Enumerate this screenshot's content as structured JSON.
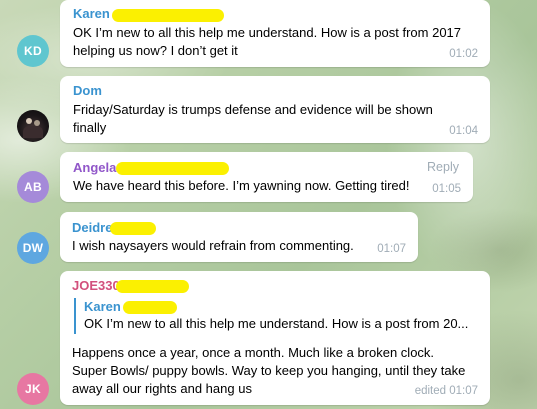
{
  "messages": [
    {
      "sender": "Karen",
      "sender_color": "#3a93cf",
      "avatar_initials": "KD",
      "avatar_color": "#5fc6cf",
      "text": "OK I’m new to all this help me understand. How is a post from 2017 helping us now? I don’t get it",
      "time": "01:02"
    },
    {
      "sender": "Dom",
      "sender_color": "#3a93cf",
      "avatar_icon": "user-photo-icon",
      "text": "Friday/Saturday is trumps defense and evidence will be shown finally",
      "time": "01:04"
    },
    {
      "sender": "Angela",
      "sender_color": "#9157c9",
      "avatar_initials": "AB",
      "avatar_color": "#a58ad9",
      "text": "We have heard this before. I’m yawning now. Getting tired!",
      "time": "01:05",
      "reply_label": "Reply"
    },
    {
      "sender": "Deidre",
      "sender_color": "#3a93cf",
      "avatar_initials": "DW",
      "avatar_color": "#5ea7e0",
      "text": "I wish naysayers would refrain from commenting.",
      "time": "01:07"
    },
    {
      "sender": "JOE330",
      "sender_color": "#d2507c",
      "avatar_initials": "JK",
      "avatar_color": "#e777a2",
      "quote_sender": "Karen",
      "quote_text": "OK I’m new to all this help me understand. How is a post from 20...",
      "text": "Happens once a year, once a month. Much like a broken clock. Super Bowls/ puppy bowls. Way to keep you hanging, until they take away all our rights and hang us",
      "time": "edited 01:07"
    }
  ],
  "colors": {
    "redaction": "#fbf001",
    "timestamp": "#a0acb6",
    "quote_bar": "#3a93cf"
  }
}
